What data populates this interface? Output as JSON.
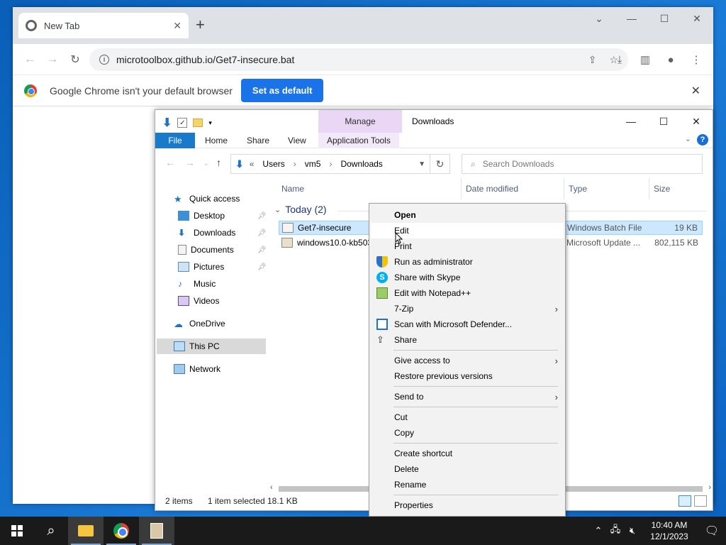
{
  "chrome": {
    "tab_title": "New Tab",
    "url": "microtoolbox.github.io/Get7-insecure.bat",
    "infobar_message": "Google Chrome isn't your default browser",
    "set_default_label": "Set as default"
  },
  "explorer": {
    "window_title": "Downloads",
    "manage_tab": "Manage",
    "ribbon_tabs": [
      "File",
      "Home",
      "Share",
      "View",
      "Application Tools"
    ],
    "breadcrumb": [
      "Users",
      "vm5",
      "Downloads"
    ],
    "breadcrumb_prefix": "«",
    "search_placeholder": "Search Downloads",
    "nav": {
      "quick_access": "Quick access",
      "desktop": "Desktop",
      "downloads": "Downloads",
      "documents": "Documents",
      "pictures": "Pictures",
      "music": "Music",
      "videos": "Videos",
      "onedrive": "OneDrive",
      "this_pc": "This PC",
      "network": "Network"
    },
    "columns": [
      "Name",
      "Date modified",
      "Type",
      "Size"
    ],
    "group_label": "Today (2)",
    "files": [
      {
        "name": "Get7-insecure",
        "type": "Windows Batch File",
        "size": "19 KB"
      },
      {
        "name": "windows10.0-kb503",
        "type": "Microsoft Update ...",
        "size": "802,115 KB"
      }
    ],
    "status": {
      "count": "2 items",
      "selection": "1 item selected",
      "size": "18.1 KB"
    }
  },
  "context_menu": {
    "open": "Open",
    "edit": "Edit",
    "print": "Print",
    "run_as_admin": "Run as administrator",
    "share_skype": "Share with Skype",
    "edit_notepadpp": "Edit with Notepad++",
    "seven_zip": "7-Zip",
    "scan_defender": "Scan with Microsoft Defender...",
    "share": "Share",
    "give_access": "Give access to",
    "restore_versions": "Restore previous versions",
    "send_to": "Send to",
    "cut": "Cut",
    "copy": "Copy",
    "create_shortcut": "Create shortcut",
    "delete": "Delete",
    "rename": "Rename",
    "properties": "Properties"
  },
  "taskbar": {
    "time": "10:40 AM",
    "date": "12/1/2023"
  },
  "colors": {
    "accent": "#1979ca",
    "chrome_button": "#1a73e8",
    "manage_tab": "#e9d7f5",
    "selection": "#cce8ff"
  }
}
